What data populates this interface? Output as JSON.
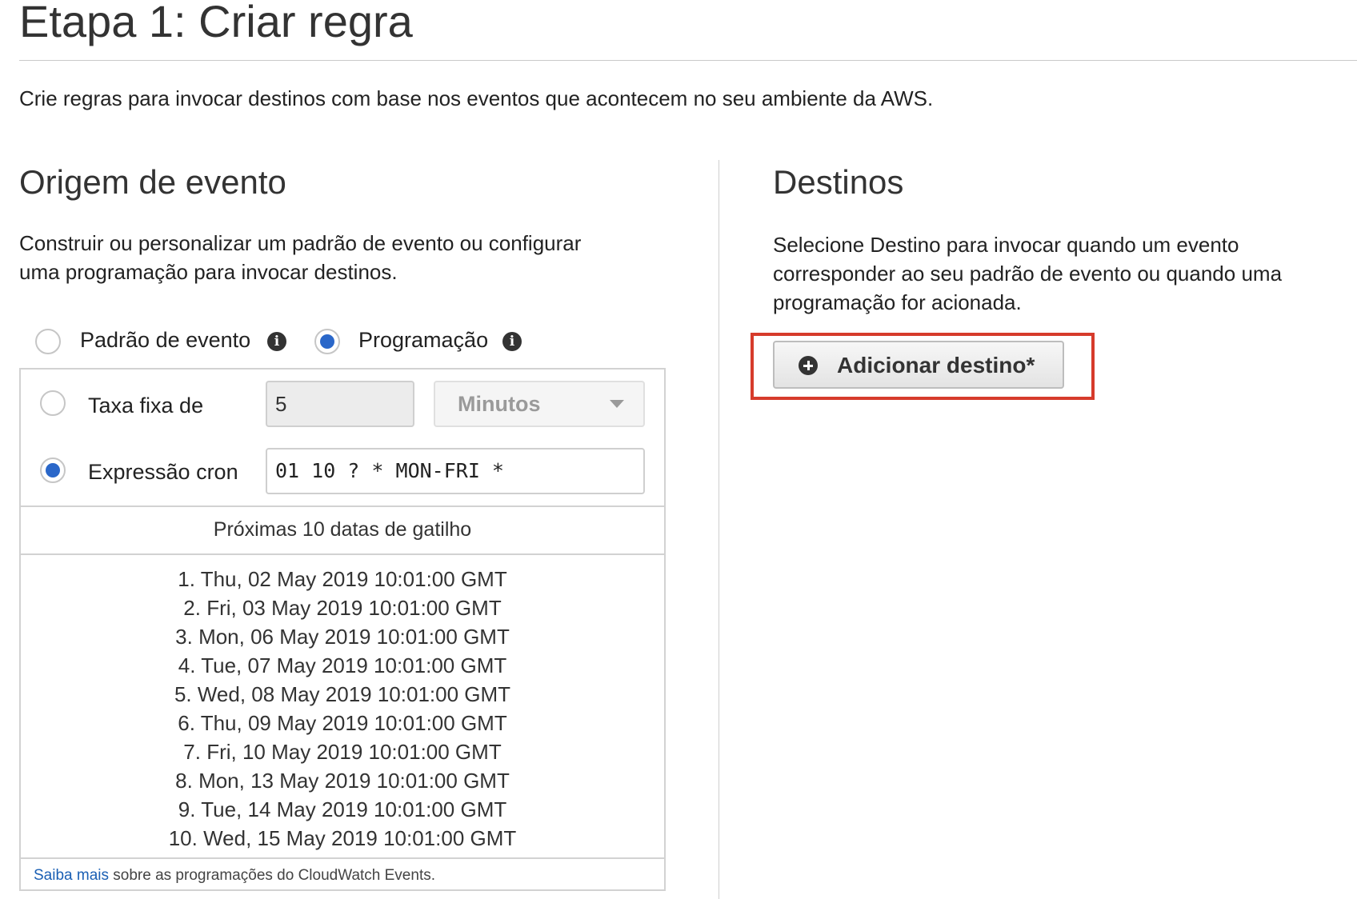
{
  "page": {
    "title": "Etapa 1: Criar regra",
    "description": "Crie regras para invocar destinos com base nos eventos que acontecem no seu ambiente da AWS."
  },
  "event_source": {
    "title": "Origem de evento",
    "description_lines": [
      "Construir ou personalizar um padrão de evento ou configurar",
      "uma programação para invocar destinos."
    ],
    "options": [
      {
        "label": "Padrão de evento",
        "selected": false
      },
      {
        "label": "Programação",
        "selected": true
      }
    ],
    "schedule": {
      "fixed_rate": {
        "label": "Taxa fixa de",
        "selected": false,
        "value": "5",
        "unit": "Minutos"
      },
      "cron": {
        "label": "Expressão cron",
        "selected": true,
        "value": "01 10 ? * MON-FRI *"
      },
      "trigger_header": "Próximas 10 datas de gatilho",
      "trigger_dates": [
        "1. Thu, 02 May 2019 10:01:00 GMT",
        "2. Fri, 03 May 2019 10:01:00 GMT",
        "3. Mon, 06 May 2019 10:01:00 GMT",
        "4. Tue, 07 May 2019 10:01:00 GMT",
        "5. Wed, 08 May 2019 10:01:00 GMT",
        "6. Thu, 09 May 2019 10:01:00 GMT",
        "7. Fri, 10 May 2019 10:01:00 GMT",
        "8. Mon, 13 May 2019 10:01:00 GMT",
        "9. Tue, 14 May 2019 10:01:00 GMT",
        "10. Wed, 15 May 2019 10:01:00 GMT"
      ],
      "footer": {
        "link": "Saiba mais",
        "text": "sobre as programações do CloudWatch Events."
      }
    }
  },
  "targets": {
    "title": "Destinos",
    "description_lines": [
      "Selecione Destino para invocar quando um evento",
      "corresponder ao seu padrão de evento ou quando uma",
      "programação for acionada."
    ],
    "add_button": "Adicionar destino*"
  },
  "colors": {
    "accent": "#2a67c9",
    "highlight": "#d63b2b",
    "link": "#1a5fb4"
  }
}
